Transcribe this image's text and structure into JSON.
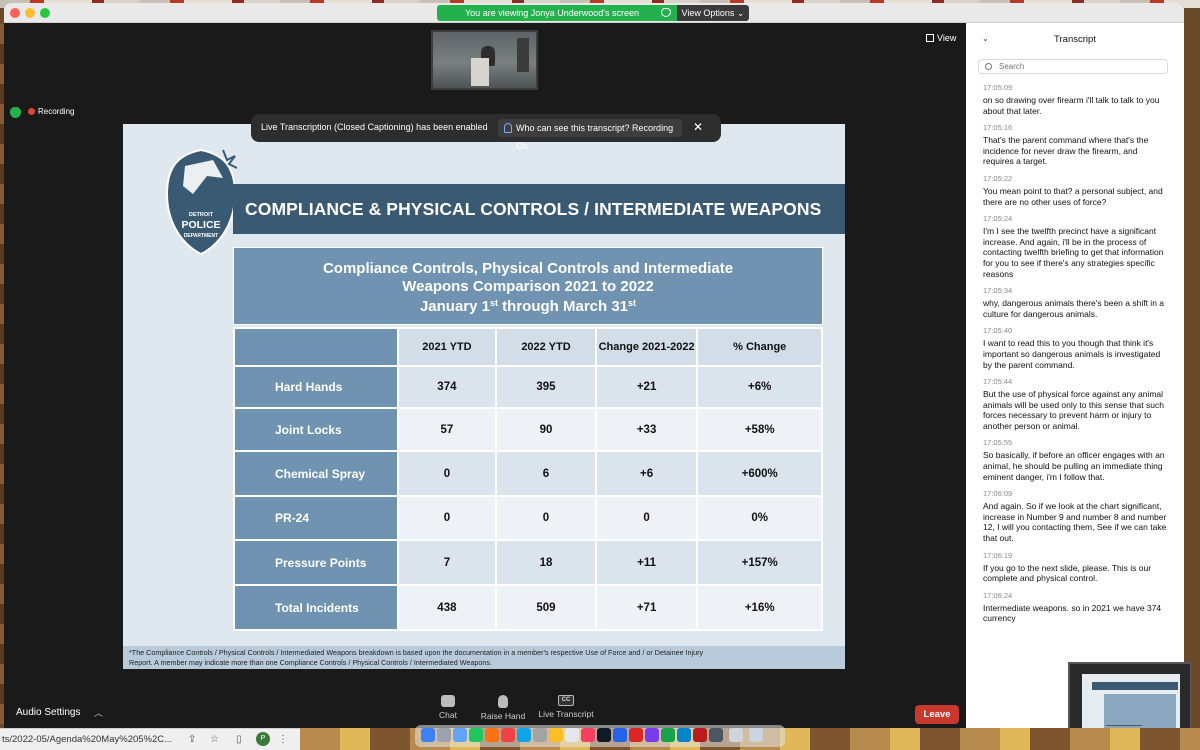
{
  "screen_share": {
    "viewing_text": "You are viewing Jonya Underwood's screen",
    "view_options_label": "View Options ⌄",
    "view_label": "View"
  },
  "recording_label": "Recording",
  "notice": {
    "text": "Live Transcription (Closed Captioning) has been enabled",
    "link": "Who can see this transcript? Recording On",
    "close": "✕"
  },
  "slide": {
    "header": "COMPLIANCE & PHYSICAL CONTROLS / INTERMEDIATE WEAPONS",
    "logo_text": [
      "DETROIT",
      "POLICE",
      "DEPARTMENT"
    ],
    "table_title_1": "Compliance Controls, Physical Controls and Intermediate",
    "table_title_2": "Weapons Comparison 2021 to 2022",
    "table_title_3a": "January 1",
    "table_title_3b": "st",
    "table_title_3c": " through March 31",
    "table_title_3d": "st",
    "columns": [
      "",
      "2021 YTD",
      "2022 YTD",
      "Change 2021-2022",
      "% Change"
    ],
    "rows": [
      {
        "label": "Hard Hands",
        "y2021": "374",
        "y2022": "395",
        "change": "+21",
        "pct": "+6%"
      },
      {
        "label": "Joint Locks",
        "y2021": "57",
        "y2022": "90",
        "change": "+33",
        "pct": "+58%"
      },
      {
        "label": "Chemical Spray",
        "y2021": "0",
        "y2022": "6",
        "change": "+6",
        "pct": "+600%"
      },
      {
        "label": "PR-24",
        "y2021": "0",
        "y2022": "0",
        "change": "0",
        "pct": "0%"
      },
      {
        "label": "Pressure Points",
        "y2021": "7",
        "y2022": "18",
        "change": "+11",
        "pct": "+157%"
      },
      {
        "label": "Total Incidents",
        "y2021": "438",
        "y2022": "509",
        "change": "+71",
        "pct": "+16%"
      }
    ],
    "footnote_1": "*The Compliance Controls / Physical Controls / Intermediated Weapons breakdown is based upon the documentation in a member's respective Use of Force and / or Detainee Injury",
    "footnote_2": "Report.  A member may indicate more than one Compliance Controls / Physical Controls / Intermediated Weapons."
  },
  "toolbar": {
    "audio_settings": "Audio Settings",
    "chat": "Chat",
    "raise_hand": "Raise Hand",
    "live_transcript": "Live Transcript",
    "cc_label": "CC",
    "leave": "Leave"
  },
  "transcript": {
    "title": "Transcript",
    "search_placeholder": "Search",
    "entries": [
      {
        "time": "17:05:09",
        "text": "on so drawing over firearm i'll talk to talk to you about that later."
      },
      {
        "time": "17:05:16",
        "text": "That's the parent command where that's the incidence for never draw the firearm, and requires a target."
      },
      {
        "time": "17:05:22",
        "text": "You mean point to that? a personal subject, and there are no other uses of force?"
      },
      {
        "time": "17:05:24",
        "text": "I'm I see the twelfth precinct have a significant increase. And again, i'll be in the process of contacting twelfth briefing to get that information for you to see if there's any strategies specific reasons"
      },
      {
        "time": "17:05:34",
        "text": "why, dangerous animals there's been a shift in a culture for dangerous animals."
      },
      {
        "time": "17:05:40",
        "text": "I want to read this to you though that think it's important so dangerous animals is investigated by the parent command."
      },
      {
        "time": "17:05:44",
        "text": "But the use of physical force against any animal animals will be used only to this sense that such forces necessary to prevent harm or injury to another person or animal."
      },
      {
        "time": "17:05:55",
        "text": "So basically, if before an officer engages with an animal, he should be pulling an immediate thing eminent danger, i'm I follow that."
      },
      {
        "time": "17:06:09",
        "text": "And again. So if we look at the chart significant, increase in Number 9 and number 8 and number 12, I will you contacting them, See if we can take that out."
      },
      {
        "time": "17:06:19",
        "text": "If you go to the next slide, please. This is our complete and physical control."
      },
      {
        "time": "17:06:24",
        "text": "Intermediate weapons. so in 2021 we have 374 currency"
      }
    ]
  },
  "browser": {
    "url": "ts/2022-05/Agenda%20May%205%2C...",
    "avatar": "P"
  }
}
